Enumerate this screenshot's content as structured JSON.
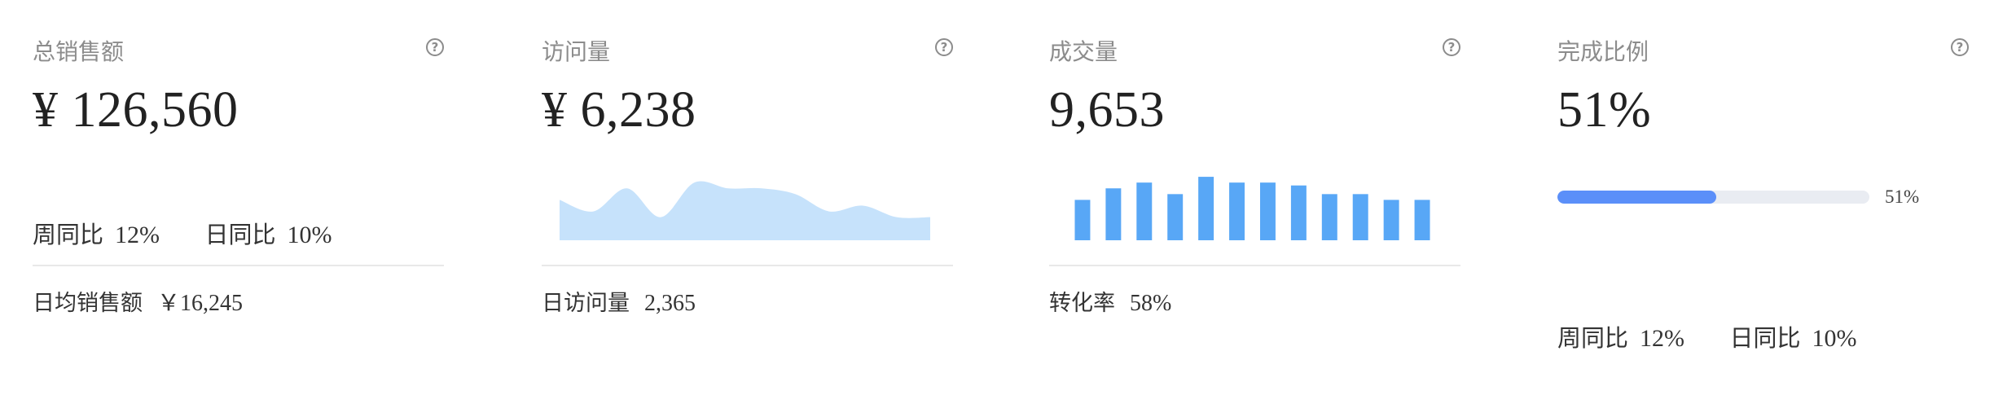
{
  "cards": [
    {
      "title": "总销售额",
      "value": "¥ 126,560",
      "trends": [
        {
          "label": "周同比",
          "value": "12%"
        },
        {
          "label": "日同比",
          "value": "10%"
        }
      ],
      "footer": {
        "label": "日均销售额",
        "value": "￥16,245"
      }
    },
    {
      "title": "访问量",
      "value": "¥ 6,238",
      "footer": {
        "label": "日访问量",
        "value": "2,365"
      }
    },
    {
      "title": "成交量",
      "value": "9,653",
      "footer": {
        "label": "转化率",
        "value": "58%"
      }
    },
    {
      "title": "完成比例",
      "value": "51%",
      "progress": {
        "percent": 51,
        "label": "51%"
      },
      "trends": [
        {
          "label": "周同比",
          "value": "12%"
        },
        {
          "label": "日同比",
          "value": "10%"
        }
      ]
    }
  ],
  "colors": {
    "area_fill": "#c6e2fb",
    "bar_fill": "#58a7f6",
    "progress_fill": "#5b8ff9",
    "progress_track": "#e9ecf2"
  },
  "icons": {
    "help": "question-circle-icon"
  },
  "chart_data": [
    {
      "type": "area",
      "values": [
        7,
        5,
        9,
        4,
        10,
        9,
        9,
        8,
        5,
        6,
        4,
        4
      ],
      "ylim": [
        0,
        12
      ]
    },
    {
      "type": "bar",
      "values": [
        7,
        9,
        10,
        8,
        11,
        10,
        10,
        9.5,
        8,
        8,
        7,
        7
      ],
      "ylim": [
        0,
        12
      ]
    }
  ]
}
